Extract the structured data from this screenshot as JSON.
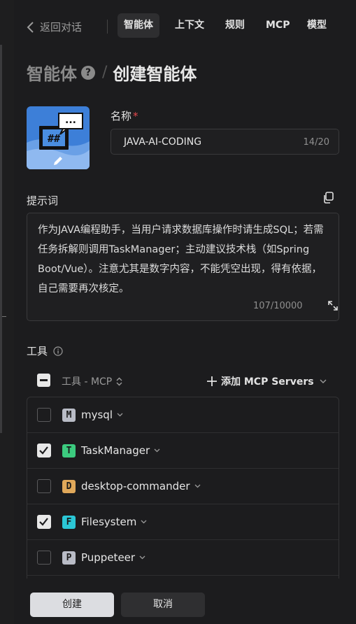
{
  "nav": {
    "back_label": "返回对话",
    "tabs": [
      {
        "label": "智能体",
        "active": true
      },
      {
        "label": "上下文",
        "active": false
      },
      {
        "label": "规则",
        "active": false
      },
      {
        "label": "MCP",
        "active": false
      },
      {
        "label": "模型",
        "active": false
      }
    ]
  },
  "breadcrumb": {
    "parent": "智能体",
    "help_glyph": "?",
    "separator": "/",
    "current": "创建智能体"
  },
  "avatar": {
    "icon": "chat-code-avatar",
    "edit_icon": "pencil-icon",
    "screen_text": "##",
    "bubble_text": "..."
  },
  "name_field": {
    "label": "名称",
    "required_mark": "*",
    "value": "JAVA-AI-CODING",
    "counter": "14/20"
  },
  "prompt_field": {
    "label": "提示词",
    "copy_icon": "copy-icon",
    "value": "作为JAVA编程助手，当用户请求数据库操作时请生成SQL；若需任务拆解则调用TaskManager；主动建议技术栈（如Spring Boot/Vue）。注意尤其是数字内容，不能凭空出现，得有依据，自己需要再次核定。",
    "counter": "107/10000",
    "expand_icon": "expand-icon"
  },
  "tools": {
    "label": "工具",
    "info_icon": "info-icon",
    "header": {
      "select_all_state": "indeterminate",
      "filter_label": "工具 - MCP",
      "filter_icon": "sort-icon",
      "add_label": "添加 MCP Servers",
      "add_icon": "plus-icon"
    },
    "items": [
      {
        "letter": "M",
        "name": "mysql",
        "checked": false,
        "color": "#b9bcc6"
      },
      {
        "letter": "T",
        "name": "TaskManager",
        "checked": true,
        "color": "#3ccb7f"
      },
      {
        "letter": "D",
        "name": "desktop-commander",
        "checked": false,
        "color": "#e0a85a"
      },
      {
        "letter": "F",
        "name": "Filesystem",
        "checked": true,
        "color": "#2bc7d6"
      },
      {
        "letter": "P",
        "name": "Puppeteer",
        "checked": false,
        "color": "#b9bcc6"
      }
    ]
  },
  "actions": {
    "create_label": "创建",
    "cancel_label": "取消"
  },
  "colors": {
    "background": "#1c1c1e",
    "required": "#e5484d",
    "primary_button": "#dcdde1"
  }
}
